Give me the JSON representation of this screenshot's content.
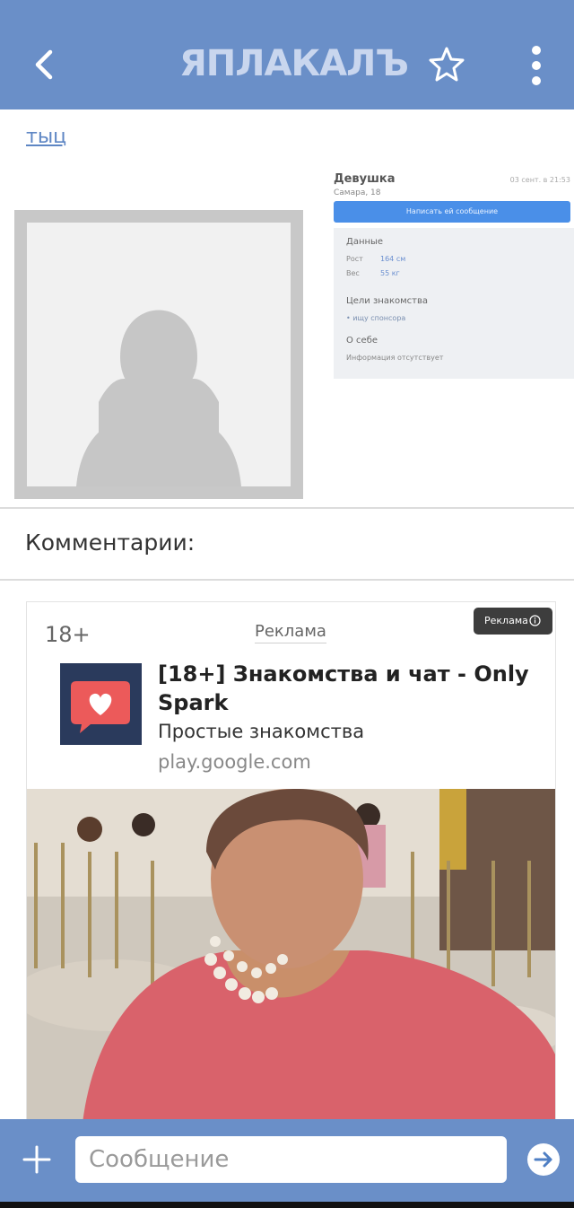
{
  "header": {
    "logo_text": "ЯПЛАКАЛЪ",
    "accent_color": "#6a8fc8",
    "icons": [
      "chevron-left-icon",
      "star-icon",
      "more-vertical-icon"
    ]
  },
  "post": {
    "link_text": "тыц",
    "profile": {
      "name": "Девушка",
      "city": "Самара, 18",
      "date": "03 сент. в 21:53",
      "message_button": "Написать ей сообщение",
      "data_heading": "Данные",
      "height_label": "Рост",
      "height_value": "164 см",
      "weight_label": "Вес",
      "weight_value": "55 кг",
      "goals_heading": "Цели знакомства",
      "goal_item": "ищу спонсора",
      "about_heading": "О себе",
      "about_text": "Информация отсутствует"
    }
  },
  "comments": {
    "title": "Комментарии:"
  },
  "ad": {
    "age_label": "18+",
    "label": "Реклама",
    "chip_label": "Реклама",
    "title": "[18+] Знакомства и чат - Only Spark",
    "description": "Простые знакомства",
    "domain": "play.google.com"
  },
  "composer": {
    "placeholder": "Сообщение",
    "icons": [
      "plus-icon",
      "send-arrow-icon"
    ]
  }
}
